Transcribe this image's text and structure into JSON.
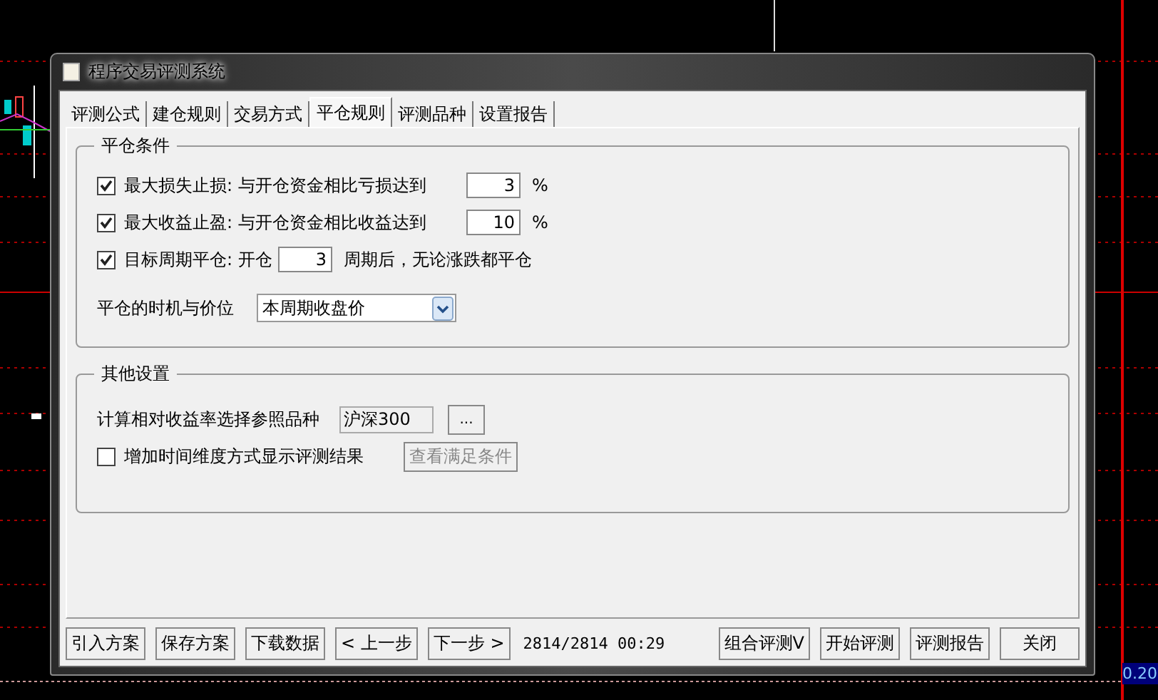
{
  "chart": {
    "axis_label": "0.20"
  },
  "window": {
    "title": "程序交易评测系统"
  },
  "tabs": [
    {
      "label": "评测公式",
      "selected": false
    },
    {
      "label": "建仓规则",
      "selected": false
    },
    {
      "label": "交易方式",
      "selected": false
    },
    {
      "label": "平仓规则",
      "selected": true
    },
    {
      "label": "评测品种",
      "selected": false
    },
    {
      "label": "设置报告",
      "selected": false
    }
  ],
  "close_conditions": {
    "title": "平仓条件",
    "rules": [
      {
        "kind": "threshold",
        "checked": true,
        "label": "最大损失止损:",
        "description": "与开仓资金相比亏损达到",
        "value": "3",
        "suffix": "%"
      },
      {
        "kind": "threshold",
        "checked": true,
        "label": "最大收益止盈:",
        "description": "与开仓资金相比收益达到",
        "value": "10",
        "suffix": "%"
      },
      {
        "kind": "period",
        "checked": true,
        "label": "目标周期平仓:",
        "description": "开仓",
        "value": "3",
        "suffix": "周期后，无论涨跌都平仓"
      }
    ],
    "timing": {
      "label": "平仓的时机与价位",
      "value": "本周期收盘价"
    }
  },
  "other_settings": {
    "title": "其他设置",
    "benchmark": {
      "label": "计算相对收益率选择参照品种",
      "value": "沪深300",
      "browse": "..."
    },
    "time_dimension": {
      "checked": false,
      "label": "增加时间维度方式显示评测结果",
      "button": "查看满足条件",
      "button_disabled": true
    }
  },
  "footer": {
    "left_buttons": [
      "引入方案",
      "保存方案",
      "下载数据",
      "< 上一步",
      "下一步 >"
    ],
    "status": "2814/2814 00:29",
    "right_buttons": [
      "组合评测V",
      "开始评测",
      "评测报告",
      "关闭"
    ]
  }
}
